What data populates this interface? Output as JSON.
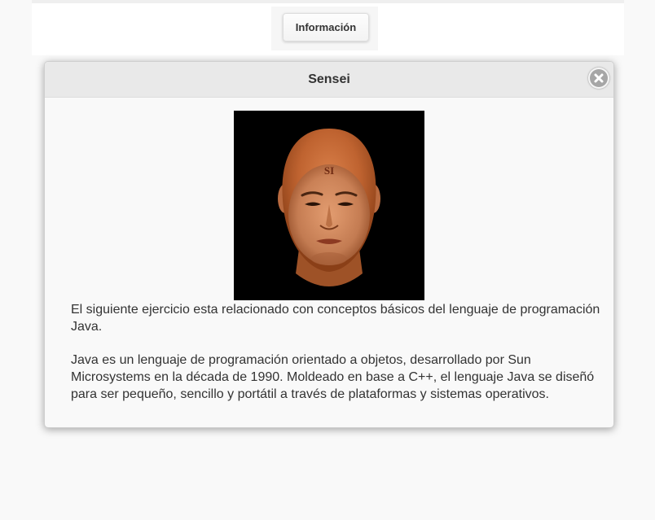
{
  "toolbar": {
    "info_button_label": "Información"
  },
  "dialog": {
    "title": "Sensei",
    "close_icon": "close-icon",
    "portrait_forehead_mark": "SI",
    "paragraphs": [
      "El siguiente ejercicio esta relacionado con conceptos básicos del lenguaje de programación Java.",
      "Java es un lenguaje de programación orientado a objetos, desarrollado por Sun Microsystems en la década de 1990. Moldeado en base a C++, el lenguaje Java se diseñó para ser pequeño, sencillo y portátil a través de plataformas y sistemas operativos."
    ]
  },
  "colors": {
    "page_background": "#f9f9f9",
    "header_background": "#e9e9e9",
    "close_icon": "#a6a6a6",
    "text": "#333333"
  }
}
